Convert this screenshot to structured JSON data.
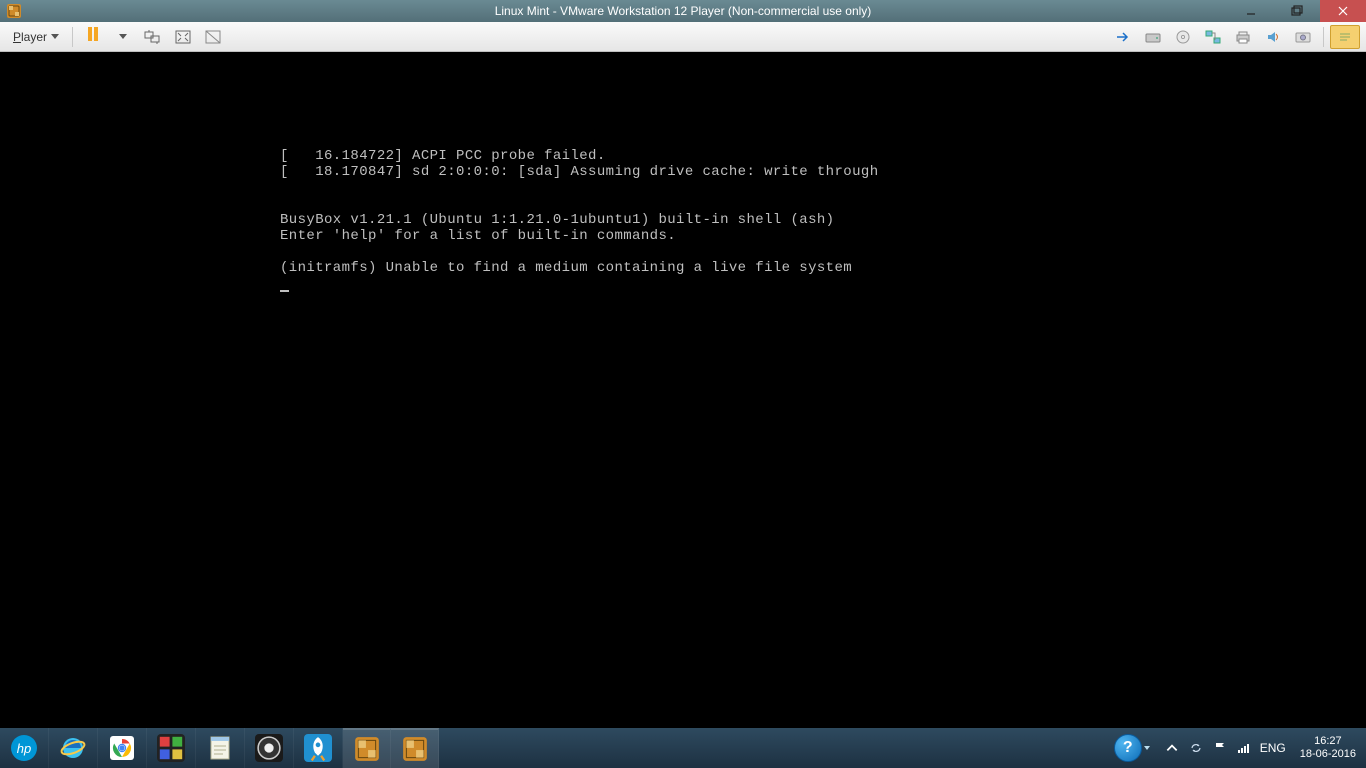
{
  "window": {
    "title": "Linux Mint - VMware Workstation 12 Player (Non-commercial use only)"
  },
  "toolbar": {
    "player_label": "Player"
  },
  "console": {
    "lines": [
      "[   16.184722] ACPI PCC probe failed.",
      "[   18.170847] sd 2:0:0:0: [sda] Assuming drive cache: write through",
      "",
      "",
      "BusyBox v1.21.1 (Ubuntu 1:1.21.0-1ubuntu1) built-in shell (ash)",
      "Enter 'help' for a list of built-in commands.",
      "",
      "(initramfs) Unable to find a medium containing a live file system"
    ]
  },
  "tray": {
    "lang": "ENG",
    "time": "16:27",
    "date": "18-06-2016"
  }
}
